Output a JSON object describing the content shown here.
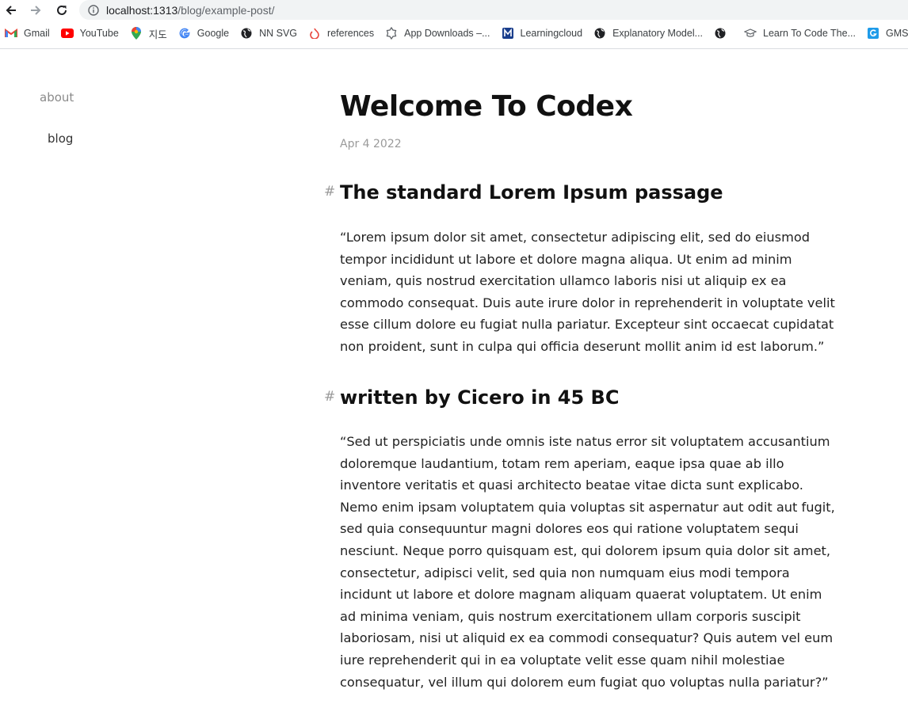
{
  "browser": {
    "url_host": "localhost:1313",
    "url_path": "/blog/example-post/",
    "bookmarks": [
      {
        "label": "Gmail",
        "icon": "gmail-icon"
      },
      {
        "label": "YouTube",
        "icon": "youtube-icon"
      },
      {
        "label": "지도",
        "icon": "maps-icon"
      },
      {
        "label": "Google",
        "icon": "google-icon"
      },
      {
        "label": "NN SVG",
        "icon": "globe-icon"
      },
      {
        "label": "references",
        "icon": "references-icon"
      },
      {
        "label": "App Downloads –...",
        "icon": "app-downloads-icon"
      },
      {
        "label": "Learningcloud",
        "icon": "learningcloud-icon"
      },
      {
        "label": "Explanatory Model...",
        "icon": "globe-icon"
      },
      {
        "label": "",
        "icon": "globe-icon"
      },
      {
        "label": "Learn To Code The...",
        "icon": "graduation-cap-icon"
      },
      {
        "label": "GMS_(",
        "icon": "gms-icon"
      }
    ]
  },
  "nav": {
    "about": "about",
    "blog": "blog"
  },
  "post": {
    "title": "Welcome To Codex",
    "date": "Apr 4 2022",
    "sections": [
      {
        "anchor": "#",
        "heading": "The standard Lorem Ipsum passage",
        "text": "“Lorem ipsum dolor sit amet, consectetur adipiscing elit, sed do eiusmod tempor incididunt ut labore et dolore magna aliqua. Ut enim ad minim veniam, quis nostrud exercitation ullamco laboris nisi ut aliquip ex ea commodo consequat. Duis aute irure dolor in reprehenderit in voluptate velit esse cillum dolore eu fugiat nulla pariatur. Excepteur sint occaecat cupidatat non proident, sunt in culpa qui officia deserunt mollit anim id est laborum.”"
      },
      {
        "anchor": "#",
        "heading": "written by Cicero in 45 BC",
        "text": "“Sed ut perspiciatis unde omnis iste natus error sit voluptatem accusantium doloremque laudantium, totam rem aperiam, eaque ipsa quae ab illo inventore veritatis et quasi architecto beatae vitae dicta sunt explicabo. Nemo enim ipsam voluptatem quia voluptas sit aspernatur aut odit aut fugit, sed quia consequuntur magni dolores eos qui ratione voluptatem sequi nesciunt. Neque porro quisquam est, qui dolorem ipsum quia dolor sit amet, consectetur, adipisci velit, sed quia non numquam eius modi tempora incidunt ut labore et dolore magnam aliquam quaerat voluptatem. Ut enim ad minima veniam, quis nostrum exercitationem ullam corporis suscipit laboriosam, nisi ut aliquid ex ea commodi consequatur? Quis autem vel eum iure reprehenderit qui in ea voluptate velit esse quam nihil molestiae consequatur, vel illum qui dolorem eum fugiat quo voluptas nulla pariatur?”"
      }
    ]
  }
}
